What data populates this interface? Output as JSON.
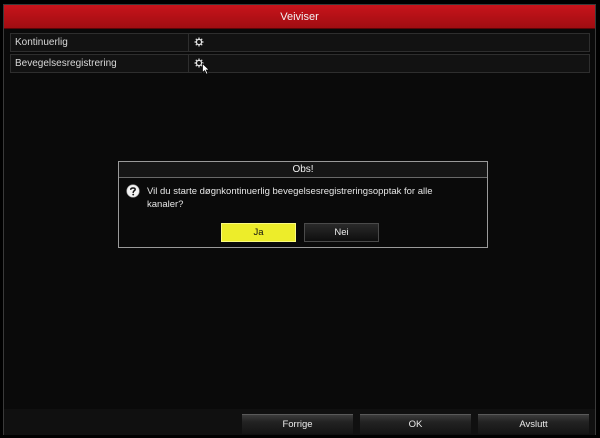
{
  "window": {
    "title": "Veiviser"
  },
  "rows": [
    {
      "label": "Kontinuerlig",
      "icon": "gear-icon"
    },
    {
      "label": "Bevegelsesregistrering",
      "icon": "gear-icon"
    }
  ],
  "dialog": {
    "title": "Obs!",
    "icon": "question-icon",
    "message": "Vil du starte døgnkontinuerlig bevegelsesregistreringsopptak for alle kanaler?",
    "yes_label": "Ja",
    "no_label": "Nei"
  },
  "footer": {
    "previous_label": "Forrige",
    "ok_label": "OK",
    "exit_label": "Avslutt"
  },
  "colors": {
    "titlebar": "#c8141b",
    "accent_button": "#eded2a"
  }
}
